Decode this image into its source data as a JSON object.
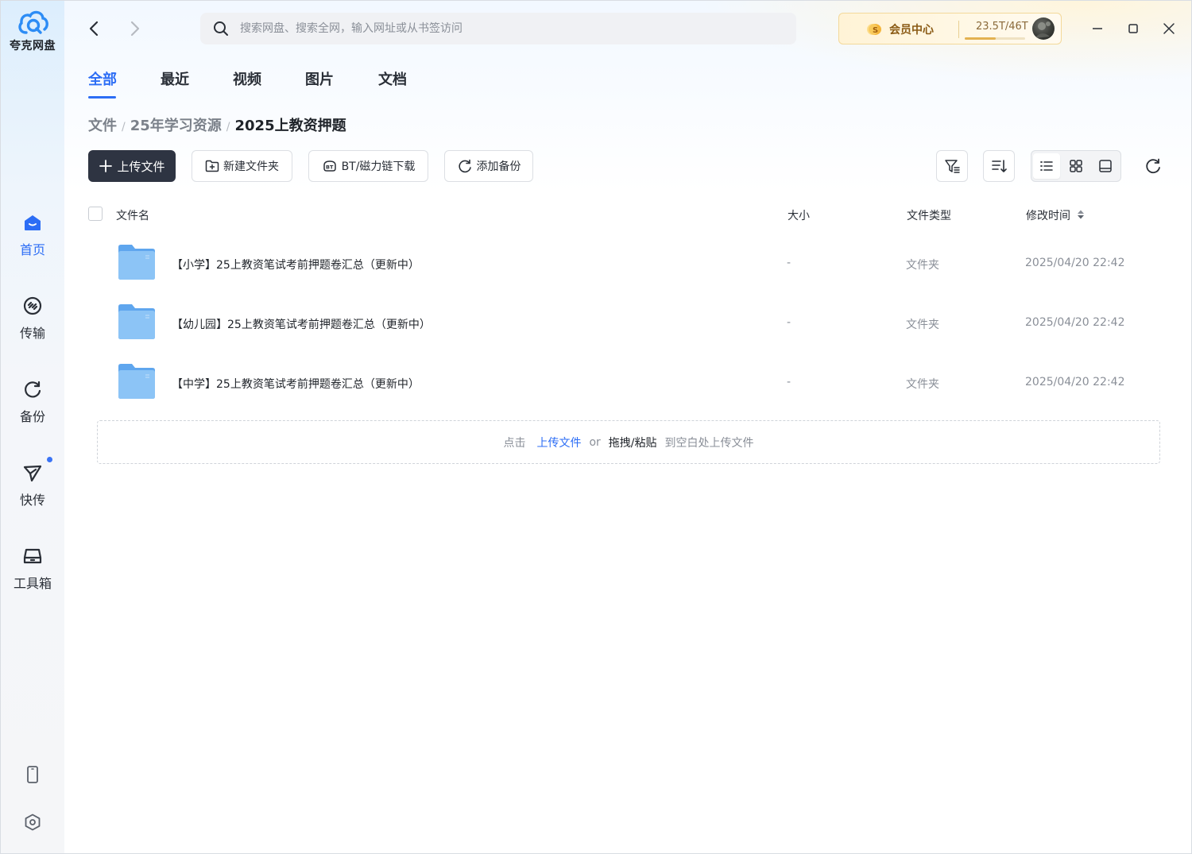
{
  "app": {
    "name": "夸克网盘"
  },
  "sidebar": {
    "items": [
      {
        "label": "首页",
        "icon": "home-icon",
        "active": true
      },
      {
        "label": "传输",
        "icon": "transfer-icon",
        "active": false
      },
      {
        "label": "备份",
        "icon": "backup-icon",
        "active": false
      },
      {
        "label": "快传",
        "icon": "send-icon",
        "active": false,
        "has_dot": true
      },
      {
        "label": "工具箱",
        "icon": "toolbox-icon",
        "active": false
      }
    ],
    "bottom_icons": [
      "phone-icon",
      "settings-icon"
    ]
  },
  "header": {
    "search_placeholder": "搜索网盘、搜索全网，输入网址或从书签访问",
    "vip_label": "会员中心",
    "storage": "23.5T/46T",
    "storage_used_fraction": 0.51
  },
  "tabs": [
    "全部",
    "最近",
    "视频",
    "图片",
    "文档"
  ],
  "active_tab": 0,
  "breadcrumb": [
    "文件",
    "25年学习资源",
    "2025上教资押题"
  ],
  "toolbar": {
    "upload": "上传文件",
    "new_folder": "新建文件夹",
    "bt": "BT/磁力链下载",
    "backup": "添加备份"
  },
  "table": {
    "headers": {
      "name": "文件名",
      "size": "大小",
      "type": "文件类型",
      "mtime": "修改时间"
    },
    "rows": [
      {
        "name": "【小学】25上教资笔试考前押题卷汇总（更新中）",
        "size": "-",
        "type": "文件夹",
        "mtime": "2025/04/20 22:42"
      },
      {
        "name": "【幼儿园】25上教资笔试考前押题卷汇总（更新中）",
        "size": "-",
        "type": "文件夹",
        "mtime": "2025/04/20 22:42"
      },
      {
        "name": "【中学】25上教资笔试考前押题卷汇总（更新中）",
        "size": "-",
        "type": "文件夹",
        "mtime": "2025/04/20 22:42"
      }
    ]
  },
  "dropzone": {
    "prefix": "点击",
    "link": "上传文件",
    "or": "or",
    "drag": "拖拽/粘贴",
    "suffix": "到空白处上传文件"
  },
  "colors": {
    "accent": "#2c6df5",
    "primary_button": "#2e3442",
    "folder": "#7cb9f2"
  }
}
